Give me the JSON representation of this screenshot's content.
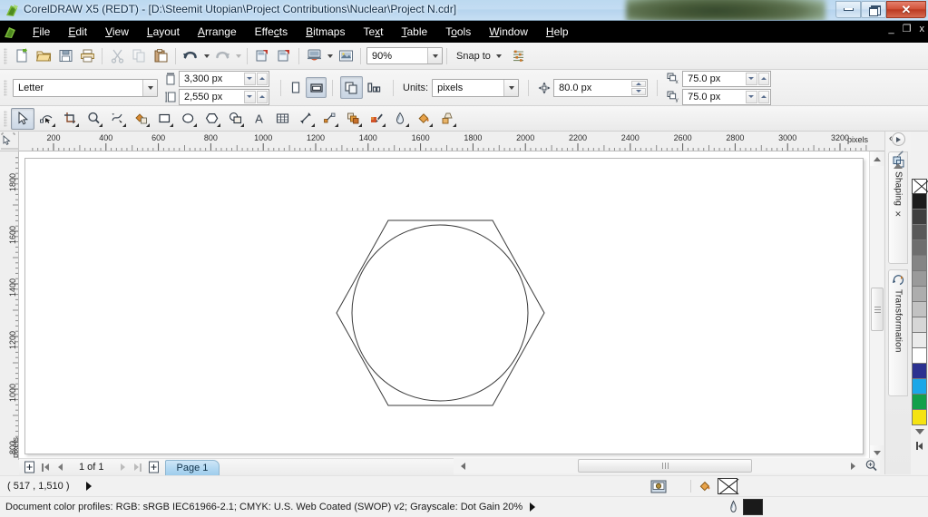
{
  "app": {
    "title": "CorelDRAW X5 (REDT) - [D:\\Steemit Utopian\\Project Contributions\\Nuclear\\Project N.cdr]",
    "icon": "coreldraw-app-icon"
  },
  "window_controls": {
    "minimize": "minimize-icon",
    "restore": "restore-icon",
    "close": "✕"
  },
  "menu": {
    "items": [
      {
        "label": "File",
        "accel": "F"
      },
      {
        "label": "Edit",
        "accel": "E"
      },
      {
        "label": "View",
        "accel": "V"
      },
      {
        "label": "Layout",
        "accel": "L"
      },
      {
        "label": "Arrange",
        "accel": "A"
      },
      {
        "label": "Effects",
        "accel": "c"
      },
      {
        "label": "Bitmaps",
        "accel": "B"
      },
      {
        "label": "Text",
        "accel": "x"
      },
      {
        "label": "Table",
        "accel": "T"
      },
      {
        "label": "Tools",
        "accel": "o"
      },
      {
        "label": "Window",
        "accel": "W"
      },
      {
        "label": "Help",
        "accel": "H"
      }
    ],
    "doc_controls": {
      "minimize": "_",
      "restore": "❐",
      "close": "x"
    }
  },
  "standard_toolbar": {
    "buttons": [
      "new-document-icon",
      "open-document-icon",
      "save-document-icon",
      "print-icon",
      "cut-icon",
      "copy-icon",
      "paste-icon",
      "undo-icon",
      "redo-icon",
      "import-icon",
      "export-icon",
      "application-launcher-icon",
      "corel-connect-icon"
    ],
    "zoom_level": "90%",
    "snap_to_label": "Snap to",
    "options_icon": "options-icon"
  },
  "property_bar": {
    "paper_type": "Letter",
    "page_width": "3,300 px",
    "page_height": "2,550 px",
    "orientation_portrait": "portrait-icon",
    "orientation_landscape": "landscape-icon",
    "all_pages_icon": "all-pages-icon",
    "current_page_icon": "current-page-icon",
    "units_label": "Units:",
    "units_value": "pixels",
    "nudge_icon": "nudge-icon",
    "nudge_value": "80.0 px",
    "duplicate_x_icon": "duplicate-offset-x-icon",
    "duplicate_x_value": "75.0 px",
    "duplicate_y_icon": "duplicate-offset-y-icon",
    "duplicate_y_value": "75.0 px"
  },
  "toolbox": {
    "tools": [
      {
        "name": "pick-tool",
        "active": true,
        "flyout": false
      },
      {
        "name": "shape-tool",
        "active": false,
        "flyout": true
      },
      {
        "name": "crop-tool",
        "active": false,
        "flyout": true
      },
      {
        "name": "zoom-tool",
        "active": false,
        "flyout": true
      },
      {
        "name": "freehand-tool",
        "active": false,
        "flyout": true
      },
      {
        "name": "smart-fill-tool",
        "active": false,
        "flyout": true
      },
      {
        "name": "rectangle-tool",
        "active": false,
        "flyout": true
      },
      {
        "name": "ellipse-tool",
        "active": false,
        "flyout": true
      },
      {
        "name": "polygon-tool",
        "active": false,
        "flyout": true
      },
      {
        "name": "basic-shapes-tool",
        "active": false,
        "flyout": true
      },
      {
        "name": "text-tool",
        "active": false,
        "flyout": false
      },
      {
        "name": "table-tool",
        "active": false,
        "flyout": false
      },
      {
        "name": "dimension-tool",
        "active": false,
        "flyout": true
      },
      {
        "name": "connector-tool",
        "active": false,
        "flyout": true
      },
      {
        "name": "blend-tool",
        "active": false,
        "flyout": true
      },
      {
        "name": "color-eyedropper-tool",
        "active": false,
        "flyout": true
      },
      {
        "name": "outline-pen-tool",
        "active": false,
        "flyout": true
      },
      {
        "name": "fill-tool",
        "active": false,
        "flyout": true
      },
      {
        "name": "interactive-fill-tool",
        "active": false,
        "flyout": true
      }
    ]
  },
  "rulers": {
    "unit_label": "pixels",
    "horizontal_ticks": [
      200,
      400,
      600,
      800,
      1000,
      1200,
      1400,
      1600,
      1800,
      2000,
      2200,
      2400,
      2600,
      2800,
      3000,
      3200
    ],
    "vertical_ticks": [
      1800,
      1600,
      1400,
      1200,
      1000,
      800
    ],
    "origin_icon": "ruler-origin-icon"
  },
  "canvas": {
    "shapes": [
      {
        "name": "hexagon-shape",
        "type": "polygon",
        "stroke": "#3a3a3a"
      },
      {
        "name": "circle-shape",
        "type": "ellipse",
        "stroke": "#3a3a3a"
      }
    ]
  },
  "page_navigator": {
    "add_page_before_icon": "add-page-before-icon",
    "first_page_icon": "first-page-icon",
    "previous_page_icon": "previous-page-icon",
    "page_indicator": "1 of 1",
    "next_page_icon": "next-page-icon",
    "last_page_icon": "last-page-icon",
    "add_page_after_icon": "add-page-after-icon",
    "tabs": [
      {
        "label": "Page 1",
        "active": true
      }
    ]
  },
  "status_bar": {
    "coordinates": "( 517  , 1,510 )",
    "expand_icon": "expand-arrow-icon",
    "color_profiles": "Document color profiles: RGB: sRGB IEC61966-2.1; CMYK: U.S. Web Coated (SWOP) v2; Grayscale: Dot Gain 20%",
    "profiles_expand_icon": "expand-arrow-icon",
    "snapshot_icon": "snapshot-icon",
    "fill_swatch_icon": "fill-color-icon",
    "fill_value": "none",
    "outline_pen_icon": "outline-pen-icon",
    "outline_color": "#1a1a1a"
  },
  "dockers": {
    "collapse_icon": "collapse-docker-icon",
    "tabs": [
      {
        "label": "Shaping",
        "icon": "shaping-icon",
        "close": "✕"
      },
      {
        "label": "Transformation",
        "icon": "transformation-icon",
        "close": ""
      }
    ]
  },
  "palette": {
    "scroll_up_icon": "palette-scroll-up-icon",
    "scroll_down_icon": "palette-scroll-down-icon",
    "expand_icon": "palette-expand-icon",
    "eyedropper_icon": "palette-eyedropper-icon",
    "swatches": [
      {
        "name": "no-color",
        "hex": "none"
      },
      {
        "name": "black",
        "hex": "#1c1c1c"
      },
      {
        "name": "gray-90",
        "hex": "#3f3f3f"
      },
      {
        "name": "gray-80",
        "hex": "#595959"
      },
      {
        "name": "gray-70",
        "hex": "#6e6e6e"
      },
      {
        "name": "gray-60",
        "hex": "#858585"
      },
      {
        "name": "gray-50",
        "hex": "#9a9a9a"
      },
      {
        "name": "gray-40",
        "hex": "#adadad"
      },
      {
        "name": "gray-30",
        "hex": "#c2c2c2"
      },
      {
        "name": "gray-20",
        "hex": "#d6d6d6"
      },
      {
        "name": "gray-10",
        "hex": "#ebebeb"
      },
      {
        "name": "white",
        "hex": "#ffffff"
      },
      {
        "name": "dark-blue",
        "hex": "#2b3190"
      },
      {
        "name": "cyan-blue",
        "hex": "#1ba7e8"
      },
      {
        "name": "green",
        "hex": "#13a04a"
      },
      {
        "name": "yellow",
        "hex": "#f5e312"
      }
    ]
  },
  "scrollbars": {
    "vertical_up_icon": "scroll-up-icon",
    "vertical_down_icon": "scroll-down-icon",
    "horizontal_left_icon": "scroll-left-icon",
    "horizontal_right_icon": "scroll-right-icon",
    "zoom_one_icon": "zoom-to-page-icon"
  }
}
